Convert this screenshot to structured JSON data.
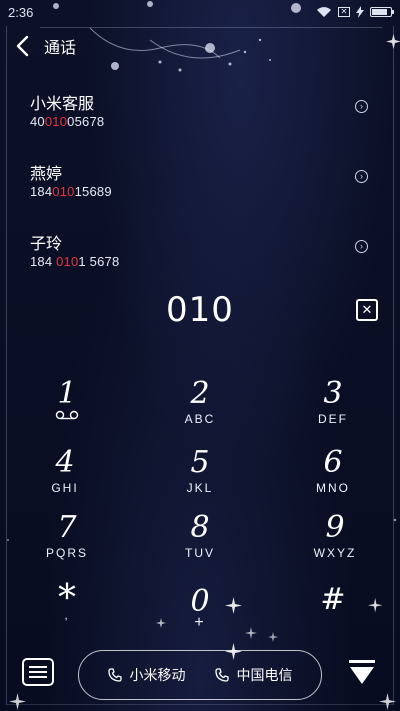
{
  "status_bar": {
    "time": "2:36",
    "battery_level": 0.85,
    "icons": [
      "wifi-icon",
      "no-sim-icon",
      "charging-icon",
      "battery-icon"
    ]
  },
  "header": {
    "title": "通话",
    "back_icon": "chevron-left-icon"
  },
  "contacts": [
    {
      "name": "小米客服",
      "number_pre": "40",
      "number_match": "010",
      "number_post": "05678"
    },
    {
      "name": "燕婷",
      "number_pre": "184",
      "number_match": "010",
      "number_post": "15689"
    },
    {
      "name": "子玲",
      "number_pre": "184 ",
      "number_match": "010",
      "number_post": "1 5678"
    }
  ],
  "dialed_number": "010",
  "keypad": [
    {
      "digit": "1",
      "letters": ""
    },
    {
      "digit": "2",
      "letters": "ABC"
    },
    {
      "digit": "3",
      "letters": "DEF"
    },
    {
      "digit": "4",
      "letters": "GHI"
    },
    {
      "digit": "5",
      "letters": "JKL"
    },
    {
      "digit": "6",
      "letters": "MNO"
    },
    {
      "digit": "7",
      "letters": "PQRS"
    },
    {
      "digit": "8",
      "letters": "TUV"
    },
    {
      "digit": "9",
      "letters": "WXYZ"
    },
    {
      "digit": "*",
      "letters": ","
    },
    {
      "digit": "0",
      "letters": "+"
    },
    {
      "digit": "#",
      "letters": ""
    }
  ],
  "bottom": {
    "sim1_label": "小米移动",
    "sim2_label": "中国电信"
  },
  "colors": {
    "background": "#0a0f24",
    "match_highlight": "#e2353c",
    "text": "#ffffff"
  }
}
